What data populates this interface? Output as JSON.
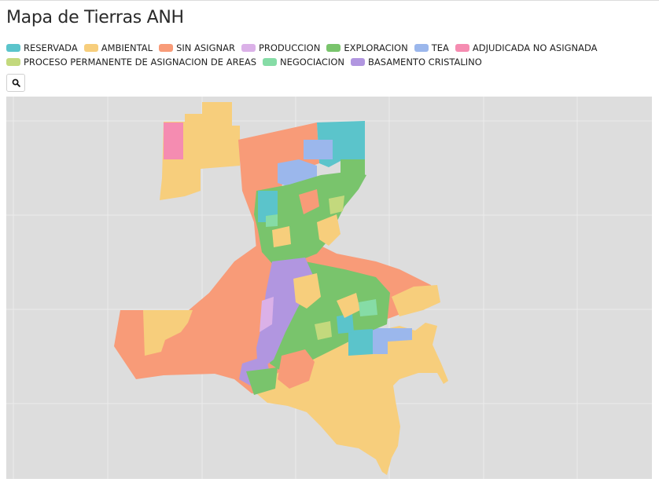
{
  "title": "Mapa de Tierras ANH",
  "legend": [
    {
      "label": "RESERVADA",
      "color": "#5bc4cb"
    },
    {
      "label": "AMBIENTAL",
      "color": "#f7ce7c"
    },
    {
      "label": "SIN ASIGNAR",
      "color": "#f89b78"
    },
    {
      "label": "PRODUCCION",
      "color": "#dbb1e8"
    },
    {
      "label": "EXPLORACION",
      "color": "#79c46c"
    },
    {
      "label": "TEA",
      "color": "#9bb7ec"
    },
    {
      "label": "ADJUDICADA NO ASIGNADA",
      "color": "#f58cb1"
    },
    {
      "label": "PROCESO PERMANENTE DE ASIGNACION DE AREAS",
      "color": "#c3d97d"
    },
    {
      "label": "NEGOCIACION",
      "color": "#86dca6"
    },
    {
      "label": "BASAMENTO CRISTALINO",
      "color": "#b196e0"
    }
  ],
  "search": {
    "icon": "search-icon"
  },
  "map": {
    "background": "#dddddd",
    "grid_color": "#ebebeb"
  }
}
